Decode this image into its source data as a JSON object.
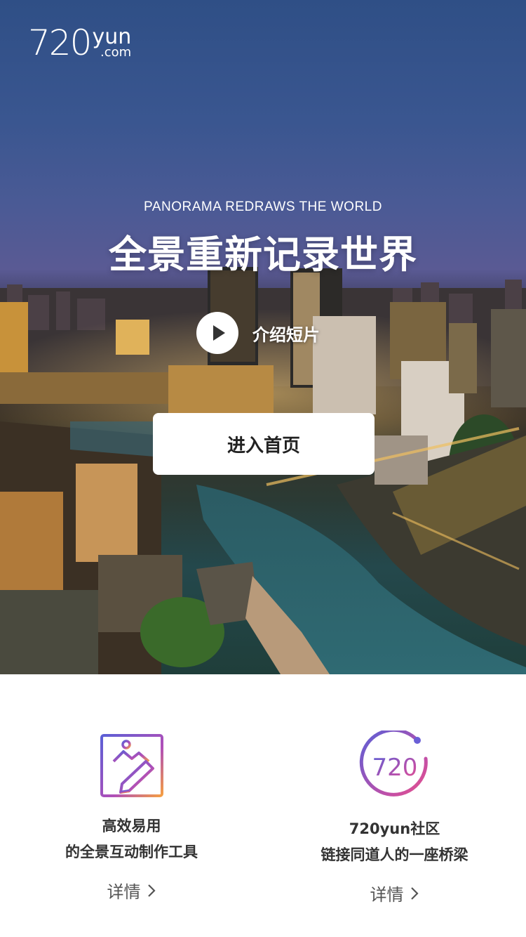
{
  "brand": {
    "logo_num": "720",
    "logo_yun": "yun",
    "logo_com": ".com"
  },
  "hero": {
    "tagline_en": "PANORAMA REDRAWS THE WORLD",
    "tagline_cn": "全景重新记录世界",
    "video_label": "介绍短片",
    "enter_button": "进入首页"
  },
  "features": {
    "left": {
      "line1": "高效易用",
      "line2": "的全景互动制作工具",
      "detail": "详情"
    },
    "right": {
      "line1": "720yun社区",
      "line2": "链接同道人的一座桥梁",
      "detail": "详情",
      "icon_text": "720"
    }
  },
  "colors": {
    "accent_purple": "#5b5fd6",
    "accent_pink": "#e8508a",
    "accent_orange": "#f59e42"
  }
}
